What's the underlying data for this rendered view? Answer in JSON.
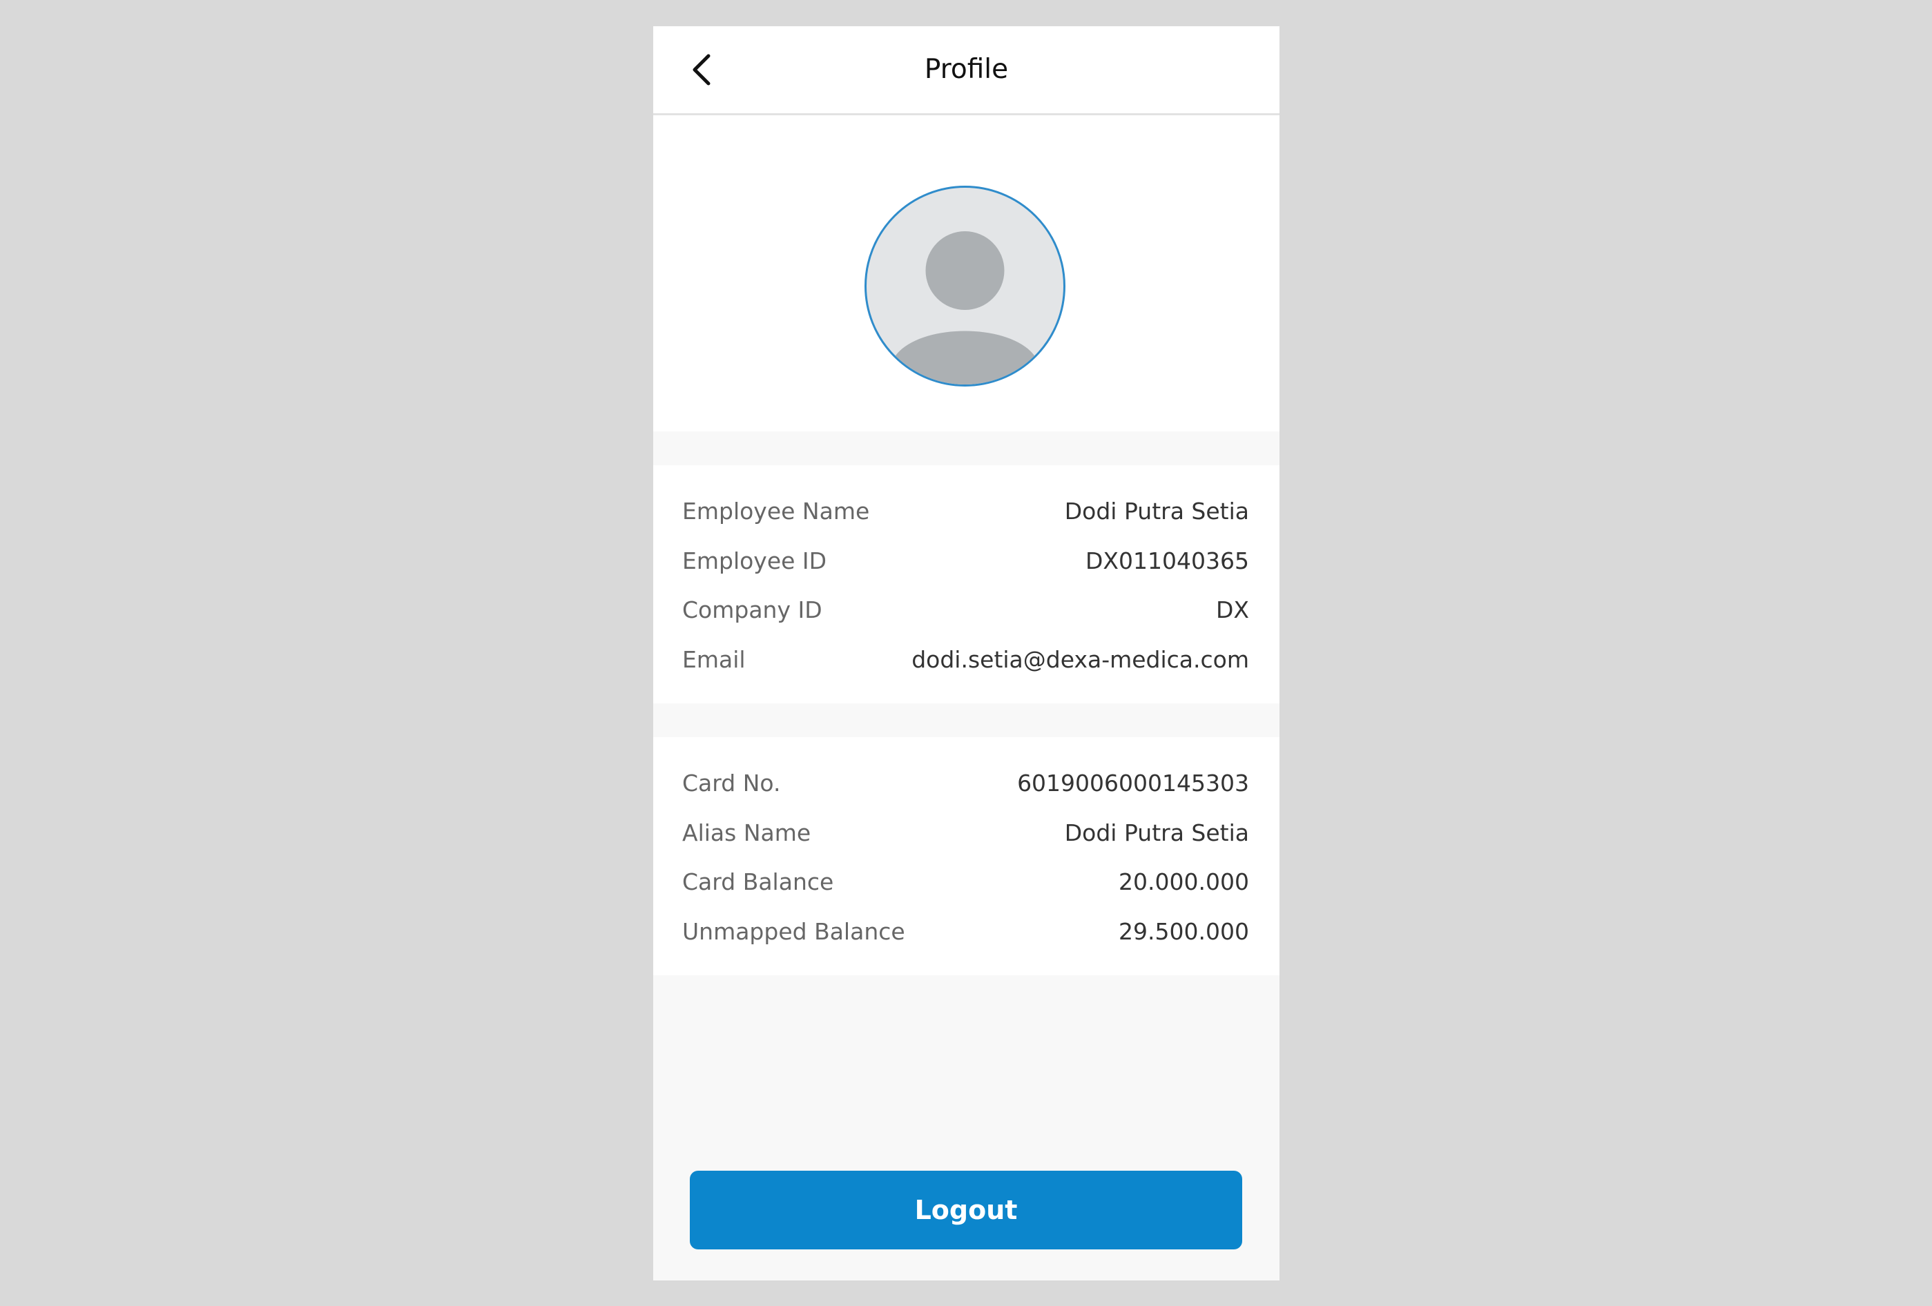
{
  "header": {
    "title": "Profile",
    "back_icon": "chevron-left-icon"
  },
  "avatar": {
    "icon": "user-placeholder-icon",
    "border_color": "#2f8ccb",
    "background_color": "#e3e5e7"
  },
  "employee_info": {
    "rows": [
      {
        "label": "Employee Name",
        "value": "Dodi Putra Setia"
      },
      {
        "label": "Employee ID",
        "value": "DX011040365"
      },
      {
        "label": "Company ID",
        "value": "DX"
      },
      {
        "label": "Email",
        "value": "dodi.setia@dexa-medica.com"
      }
    ]
  },
  "card_info": {
    "rows": [
      {
        "label": "Card No.",
        "value": "6019006000145303"
      },
      {
        "label": "Alias Name",
        "value": "Dodi Putra Setia"
      },
      {
        "label": "Card Balance",
        "value": "20.000.000"
      },
      {
        "label": "Unmapped Balance",
        "value": "29.500.000"
      }
    ]
  },
  "actions": {
    "logout_label": "Logout",
    "accent_color": "#0c86cc"
  }
}
